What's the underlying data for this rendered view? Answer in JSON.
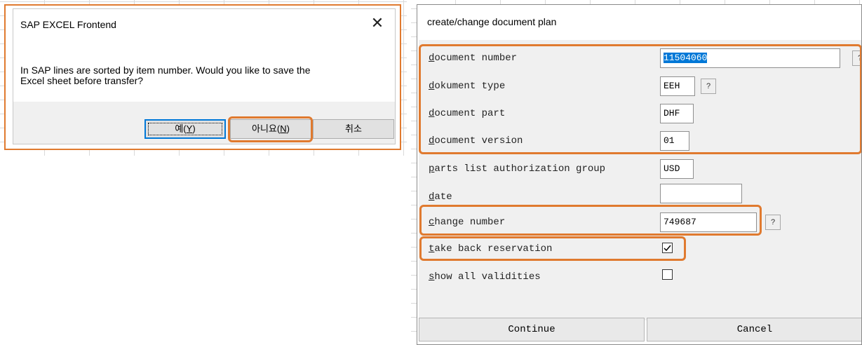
{
  "left_dialog": {
    "title": "SAP EXCEL Frontend",
    "message_line1": "In SAP lines are sorted by item number. Would you like to save the",
    "message_line2": "Excel sheet before transfer?",
    "close_glyph": "✕",
    "buttons": {
      "yes_label": "예(Y)",
      "no_label": "아니요(N)",
      "cancel_label": "취소"
    }
  },
  "right_dialog": {
    "title": "create/change document plan",
    "fields": {
      "document_number": {
        "label": "document number",
        "value": "11504060"
      },
      "document_type": {
        "label": "dokument type",
        "value": "EEH"
      },
      "document_part": {
        "label": "document part",
        "value": "DHF"
      },
      "document_version": {
        "label": "document version",
        "value": "01"
      },
      "authorization_group": {
        "label": "parts list authorization group",
        "value": "USD"
      },
      "date": {
        "label": "date",
        "value": ""
      },
      "change_number": {
        "label": "change number",
        "value": "749687"
      },
      "take_back_reservation": {
        "label": "take back reservation",
        "checked": true
      },
      "show_all_validities": {
        "label": "show all validities",
        "checked": false
      }
    },
    "help_glyph": "?",
    "buttons": {
      "continue_label": "Continue",
      "cancel_label": "Cancel"
    }
  },
  "colors": {
    "highlight": "#e07a2f",
    "selection": "#0078d7",
    "dialog_bg": "#f0f0f0"
  }
}
